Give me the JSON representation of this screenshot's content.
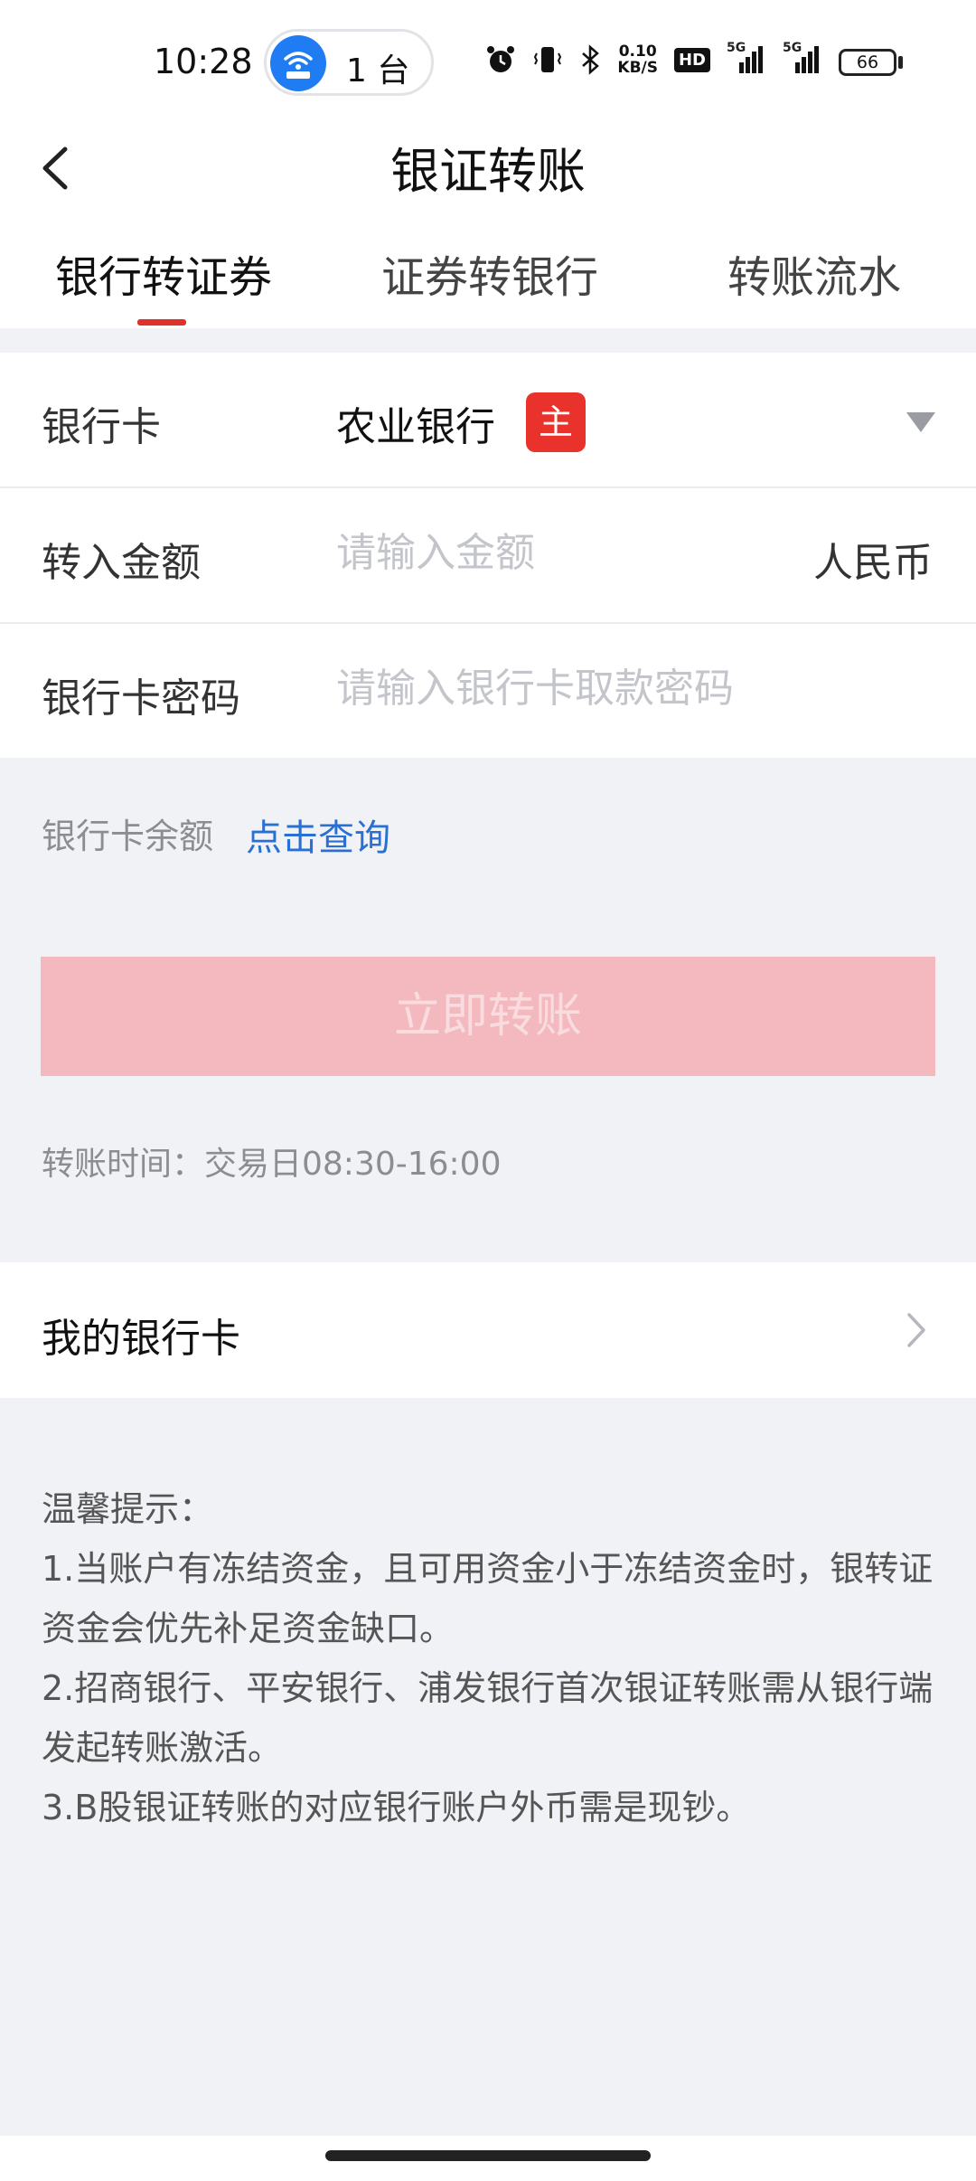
{
  "status_bar": {
    "time": "10:28",
    "hotspot_count": "1 台",
    "net_speed_value": "0.10",
    "net_speed_unit": "KB/S",
    "battery": "66",
    "signal_label_1": "5G",
    "signal_label_2": "5G",
    "hd_label": "HD"
  },
  "nav": {
    "title": "银证转账"
  },
  "tabs": [
    {
      "label": "银行转证券",
      "active": true
    },
    {
      "label": "证券转银行",
      "active": false
    },
    {
      "label": "转账流水",
      "active": false
    }
  ],
  "form": {
    "bank_card_label": "银行卡",
    "bank_card_value": "农业银行",
    "primary_badge": "主",
    "amount_label": "转入金额",
    "amount_placeholder": "请输入金额",
    "currency": "人民币",
    "password_label": "银行卡密码",
    "password_placeholder": "请输入银行卡取款密码"
  },
  "balance": {
    "label": "银行卡余额",
    "link": "点击查询"
  },
  "submit_label": "立即转账",
  "transfer_time": "转账时间：交易日08:30-16:00",
  "my_cards_label": "我的银行卡",
  "tips": {
    "title": "温馨提示：",
    "items": [
      "1.当账户有冻结资金，且可用资金小于冻结资金时，银转证资金会优先补足资金缺口。",
      "2.招商银行、平安银行、浦发银行首次银证转账需从银行端发起转账激活。",
      "3.B股银证转账的对应银行账户外币需是现钞。"
    ]
  },
  "colors": {
    "accent_red": "#e0322c",
    "link_blue": "#2a6fd3",
    "button_disabled": "#f3b9be",
    "hotspot_blue": "#1f7cf2"
  }
}
